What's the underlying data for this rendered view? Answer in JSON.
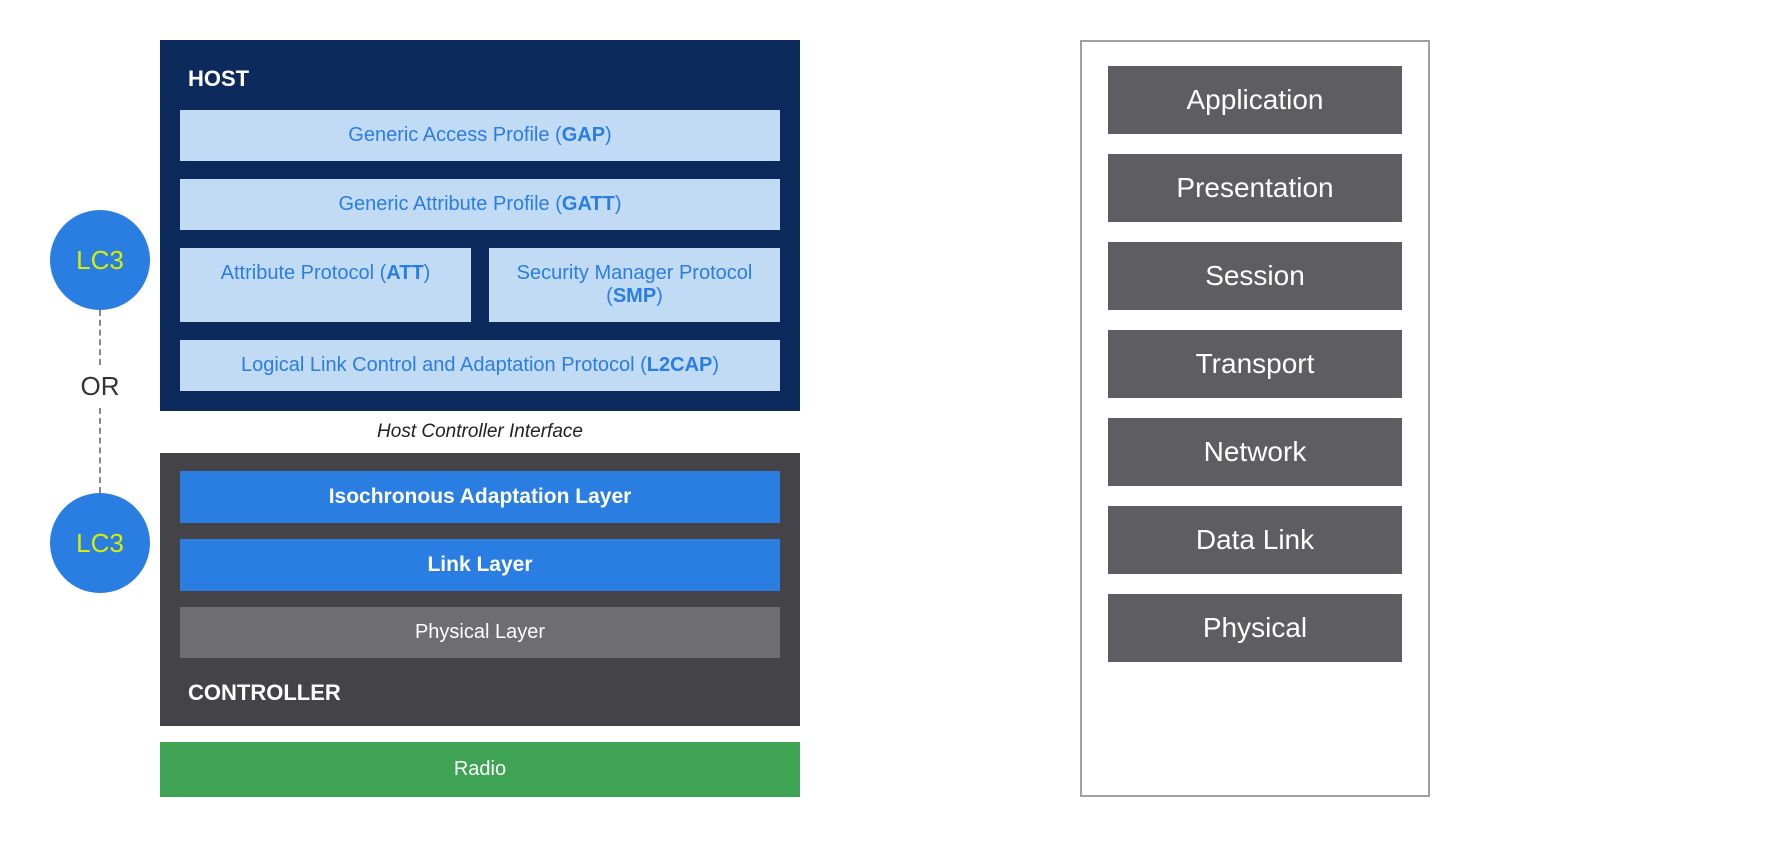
{
  "left": {
    "lc3_top": "LC3",
    "or_label": "OR",
    "lc3_bottom": "LC3"
  },
  "host": {
    "title": "HOST",
    "gap": {
      "text": "Generic Access Profile (",
      "abbr": "GAP",
      "close": ")"
    },
    "gatt": {
      "text": "Generic Attribute Profile (",
      "abbr": "GATT",
      "close": ")"
    },
    "att": {
      "text": "Attribute Protocol (",
      "abbr": "ATT",
      "close": ")"
    },
    "smp": {
      "text": "Security Manager Protocol (",
      "abbr": "SMP",
      "close": ")"
    },
    "l2cap": {
      "text": "Logical Link Control and Adaptation Protocol (",
      "abbr": "L2CAP",
      "close": ")"
    }
  },
  "hci": "Host Controller Interface",
  "controller": {
    "title": "CONTROLLER",
    "ial": "Isochronous Adaptation Layer",
    "link_layer": "Link Layer",
    "phy": "Physical Layer"
  },
  "radio": "Radio",
  "osi": {
    "layers": [
      "Application",
      "Presentation",
      "Session",
      "Transport",
      "Network",
      "Data Link",
      "Physical"
    ]
  }
}
